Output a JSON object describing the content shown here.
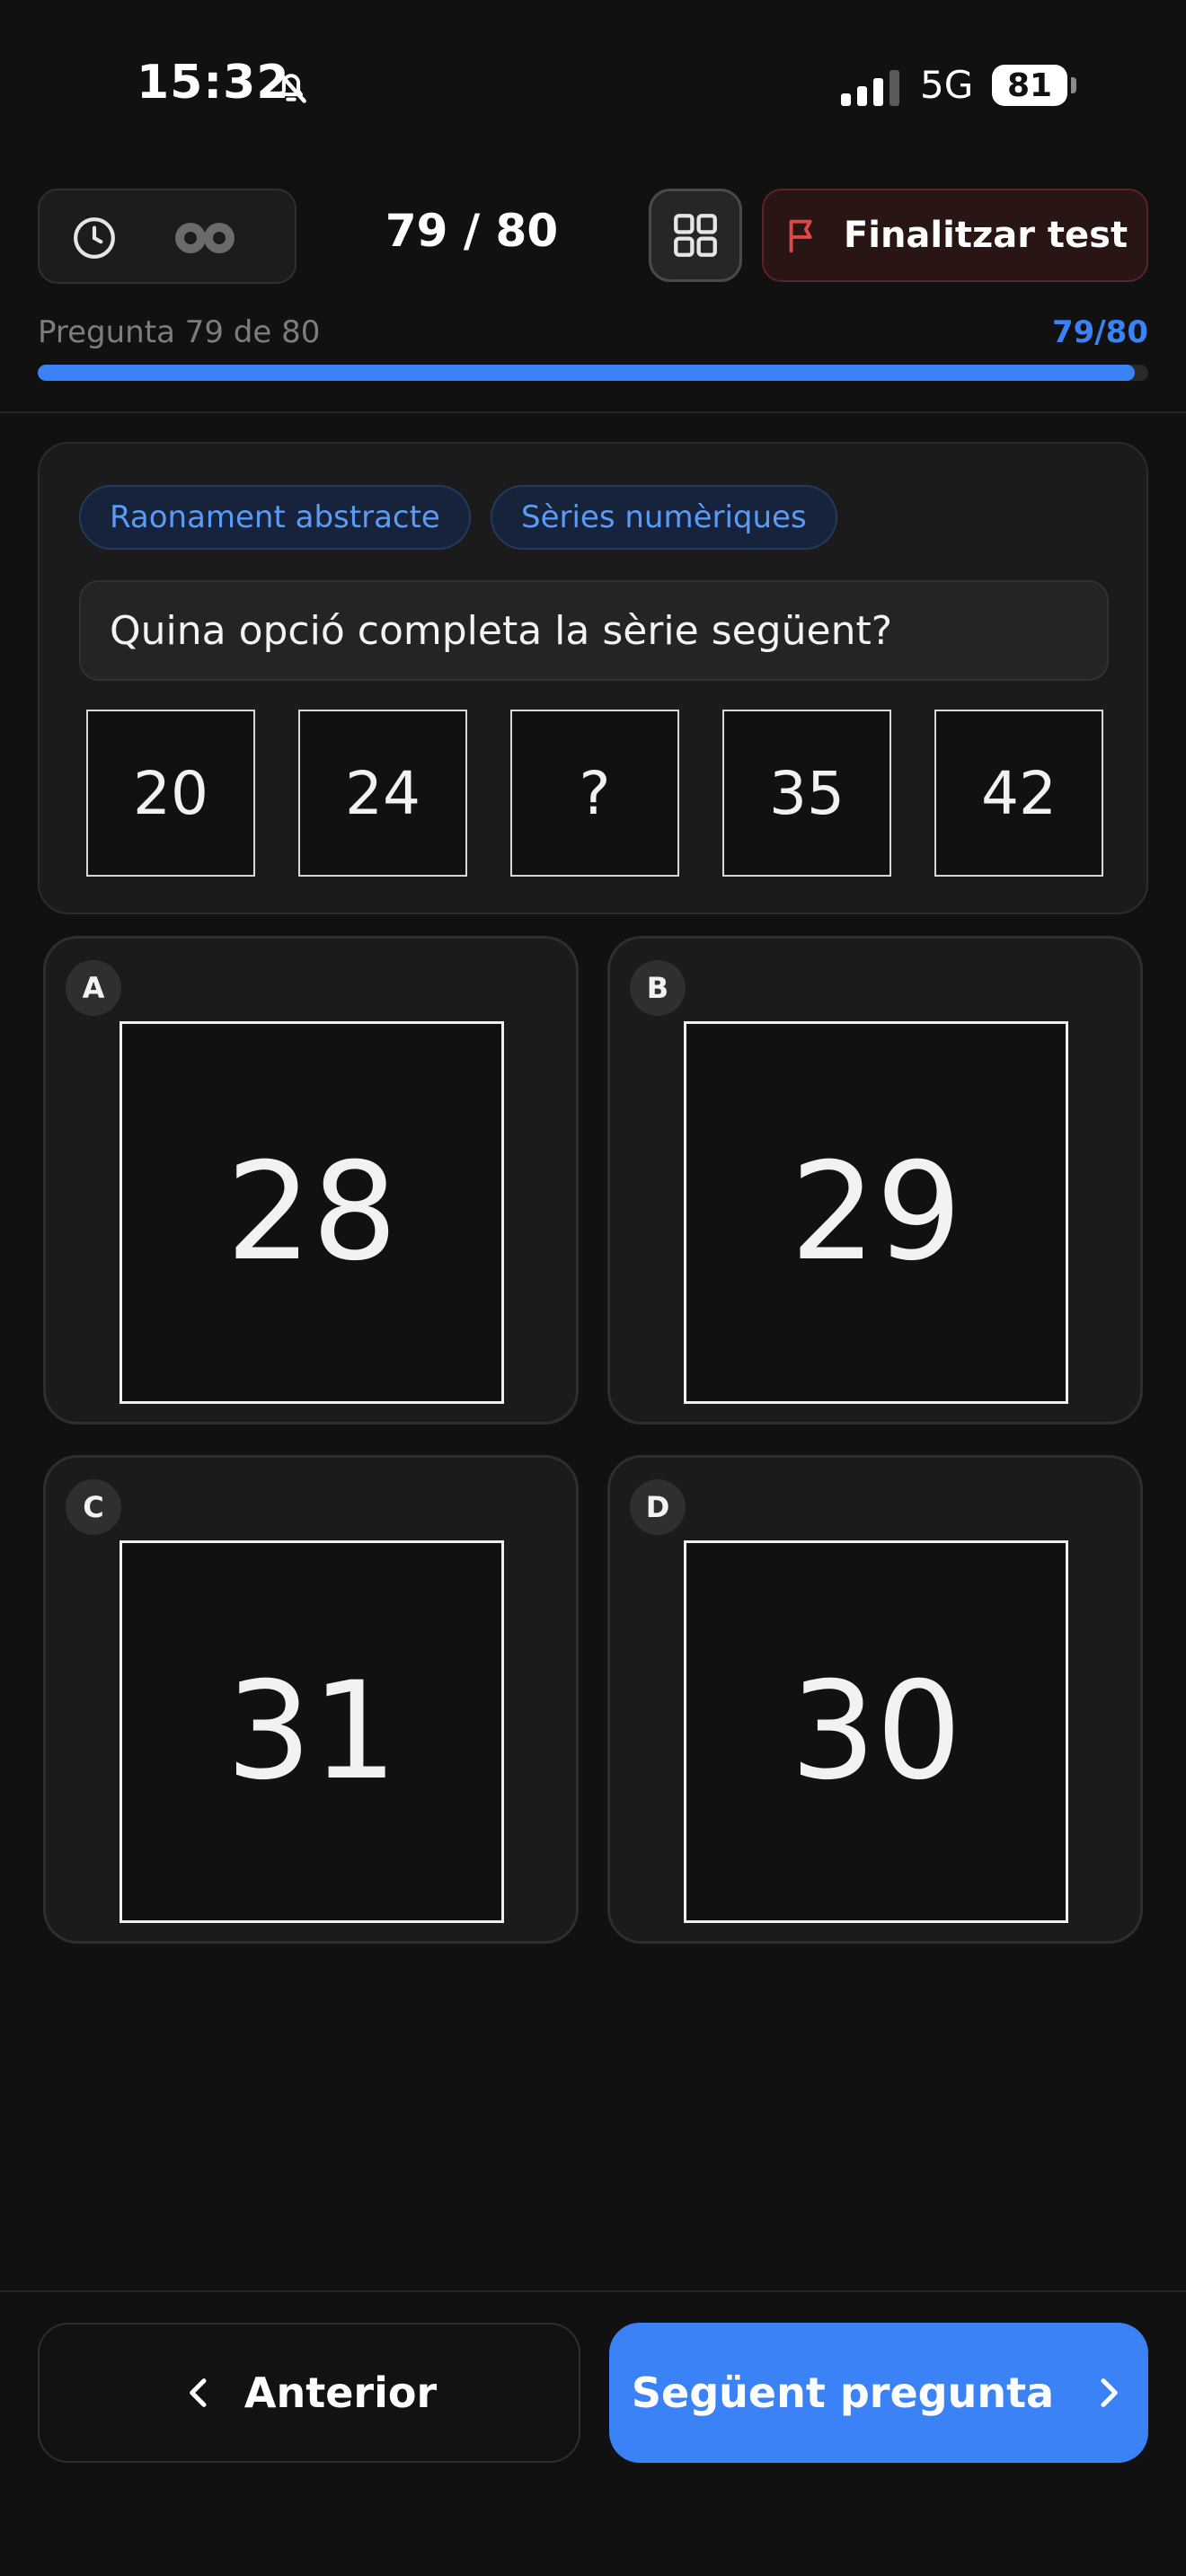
{
  "status_bar": {
    "time": "15:32",
    "network": "5G",
    "battery": "81"
  },
  "header": {
    "counter": "79 / 80",
    "finish_label": "Finalitzar test",
    "progress_label": "Pregunta 79 de 80",
    "progress_count": "79/80",
    "progress_fraction": 0.9875
  },
  "question": {
    "tags": [
      "Raonament abstracte",
      "Sèries numèriques"
    ],
    "prompt": "Quina opció completa la sèrie següent?",
    "series": [
      "20",
      "24",
      "?",
      "35",
      "42"
    ]
  },
  "options": [
    {
      "letter": "A",
      "value": "28"
    },
    {
      "letter": "B",
      "value": "29"
    },
    {
      "letter": "C",
      "value": "31"
    },
    {
      "letter": "D",
      "value": "30"
    }
  ],
  "footer": {
    "prev_label": "Anterior",
    "next_label": "Següent pregunta"
  },
  "colors": {
    "accent": "#3b82f6",
    "danger": "#e04848",
    "background": "#111111"
  }
}
